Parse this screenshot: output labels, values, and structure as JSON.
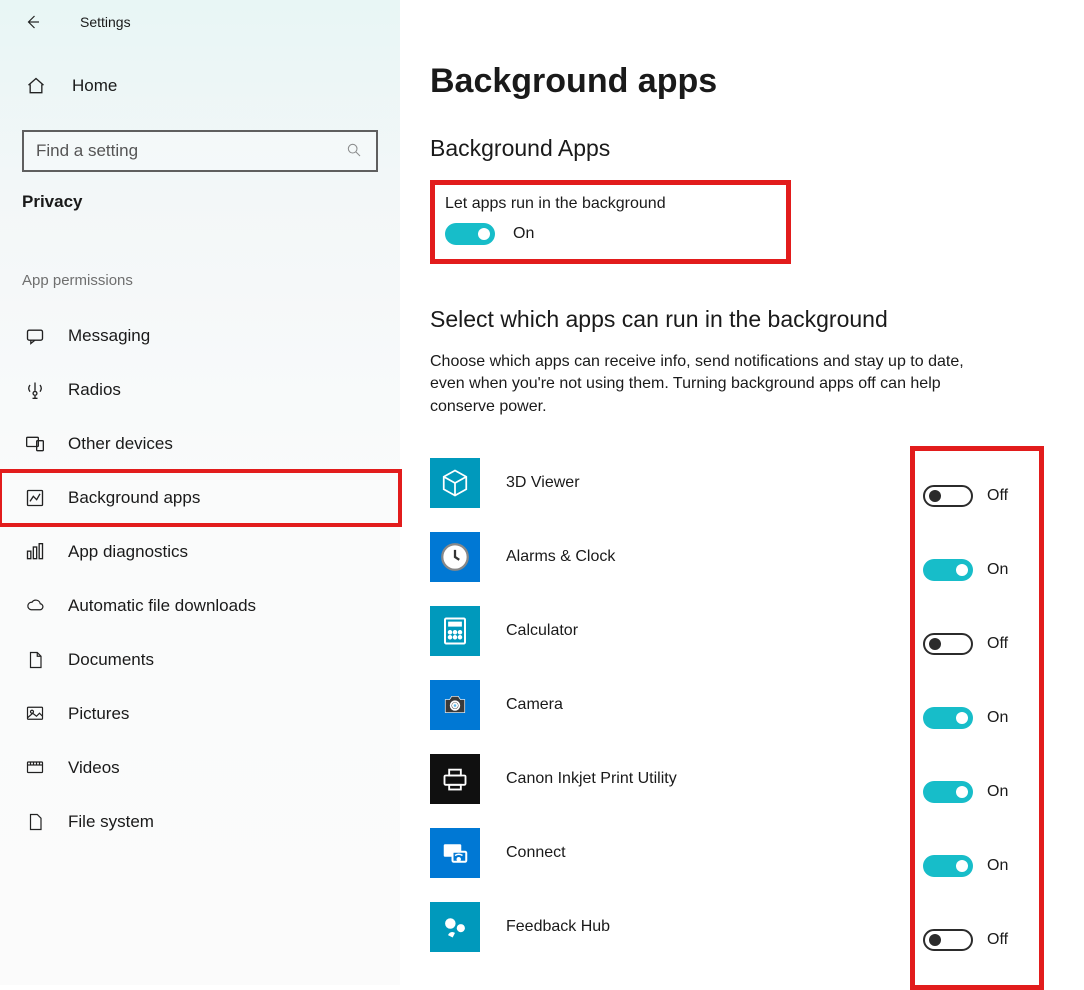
{
  "window_title": "Settings",
  "sidebar": {
    "home_label": "Home",
    "search_placeholder": "Find a setting",
    "category_label": "Privacy",
    "section_label": "App permissions",
    "items": [
      {
        "label": "Messaging",
        "icon": "message-icon"
      },
      {
        "label": "Radios",
        "icon": "radios-icon"
      },
      {
        "label": "Other devices",
        "icon": "devices-icon"
      },
      {
        "label": "Background apps",
        "icon": "background-apps-icon",
        "highlighted": true
      },
      {
        "label": "App diagnostics",
        "icon": "diagnostics-icon"
      },
      {
        "label": "Automatic file downloads",
        "icon": "cloud-download-icon"
      },
      {
        "label": "Documents",
        "icon": "document-icon"
      },
      {
        "label": "Pictures",
        "icon": "picture-icon"
      },
      {
        "label": "Videos",
        "icon": "video-icon"
      },
      {
        "label": "File system",
        "icon": "file-system-icon"
      }
    ]
  },
  "main": {
    "page_title": "Background apps",
    "section1_title": "Background Apps",
    "master_toggle_label": "Let apps run in the background",
    "master_toggle_state": "On",
    "section2_title": "Select which apps can run in the background",
    "section2_desc": "Choose which apps can receive info, send notifications and stay up to date, even when you're not using them. Turning background apps off can help conserve power.",
    "apps": [
      {
        "name": "3D Viewer",
        "state": "Off",
        "icon_bg": "#0099bc"
      },
      {
        "name": "Alarms & Clock",
        "state": "On",
        "icon_bg": "#0078d4"
      },
      {
        "name": "Calculator",
        "state": "Off",
        "icon_bg": "#0099bc"
      },
      {
        "name": "Camera",
        "state": "On",
        "icon_bg": "#0078d4"
      },
      {
        "name": "Canon Inkjet Print Utility",
        "state": "On",
        "icon_bg": "#101010"
      },
      {
        "name": "Connect",
        "state": "On",
        "icon_bg": "#0078d4"
      },
      {
        "name": "Feedback Hub",
        "state": "Off",
        "icon_bg": "#0099bc"
      }
    ]
  },
  "colors": {
    "accent": "#17bdc9",
    "highlight": "#e21c1c"
  }
}
